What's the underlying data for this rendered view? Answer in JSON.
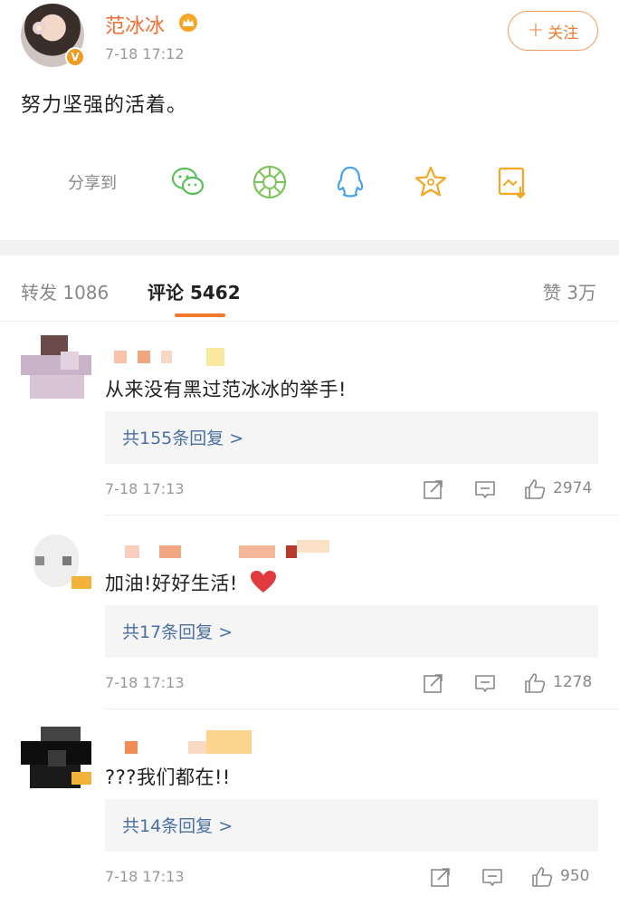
{
  "post": {
    "author": "范冰冰",
    "time": "7-18 17:12",
    "content": "努力坚强的活着。",
    "follow_label": "关注",
    "verified_badge": "V"
  },
  "share": {
    "label": "分享到",
    "targets": [
      "wechat-icon",
      "moments-icon",
      "qq-icon",
      "favorite-star-icon",
      "save-image-icon"
    ]
  },
  "tabs": {
    "repost": "转发 1086",
    "comments": "评论 5462",
    "likes": "赞 3万"
  },
  "comments": [
    {
      "text": "从来没有黑过范冰冰的举手!",
      "replies": "共155条回复 >",
      "time": "7-18 17:13",
      "likes": "2974"
    },
    {
      "text": "加油!好好生活!",
      "replies": "共17条回复 >",
      "time": "7-18 17:13",
      "likes": "1278"
    },
    {
      "text": "???我们都在!!",
      "replies": "共14条回复 >",
      "time": "7-18 17:13",
      "likes": "950"
    }
  ],
  "colors": {
    "accent": "#f07a2e",
    "link": "#4a6fa1",
    "muted": "#999999"
  }
}
